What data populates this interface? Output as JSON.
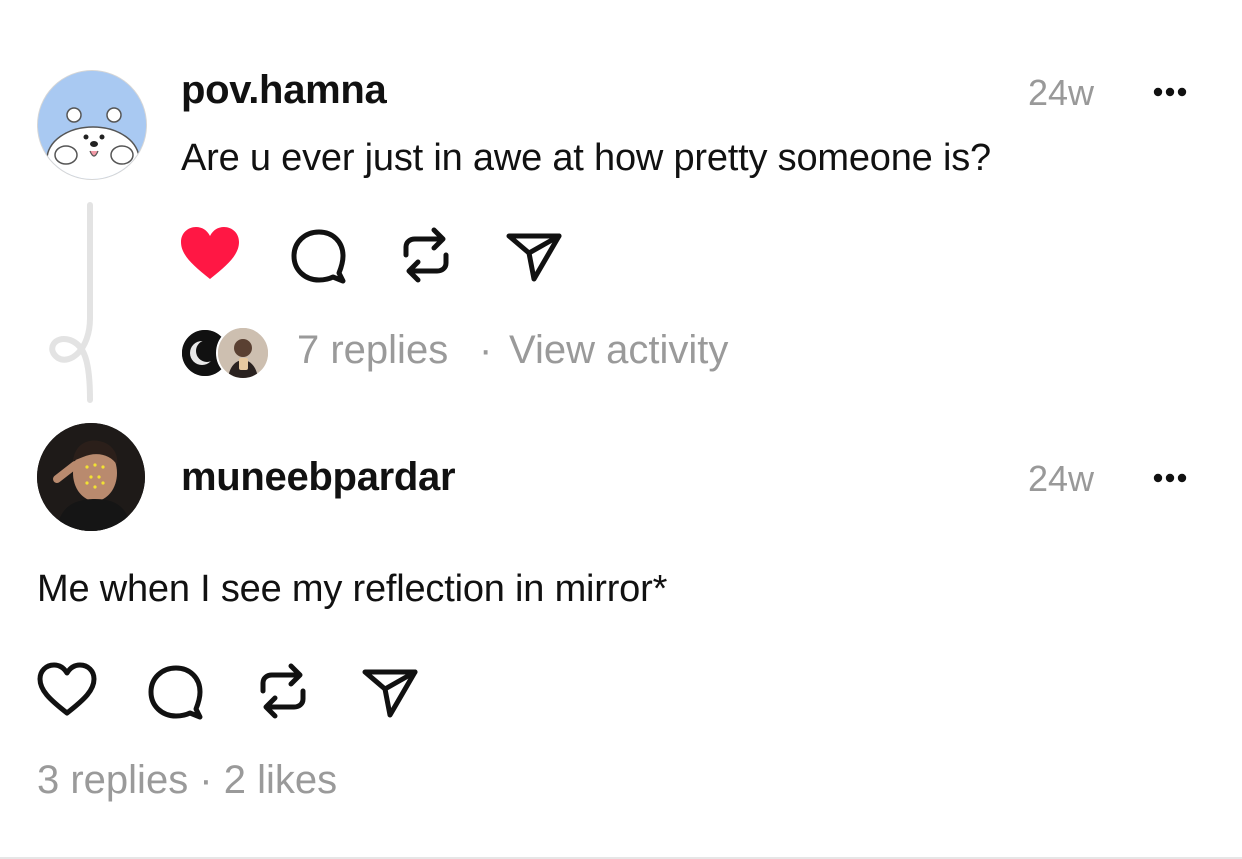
{
  "post": {
    "username": "pov.hamna",
    "time": "24w",
    "text": "Are u ever just in awe at how pretty someone is?",
    "liked": true,
    "replies_text": "7 replies",
    "separator": "·",
    "view_activity": "View activity",
    "colors": {
      "like": "#ff1744",
      "meta": "#9a9a9a",
      "thread_line": "#e3e3e3"
    }
  },
  "reply": {
    "username": "muneebpardar",
    "time": "24w",
    "text": "Me when I see my reflection in mirror*",
    "liked": false,
    "stats_text": "3 replies · 2 likes"
  }
}
